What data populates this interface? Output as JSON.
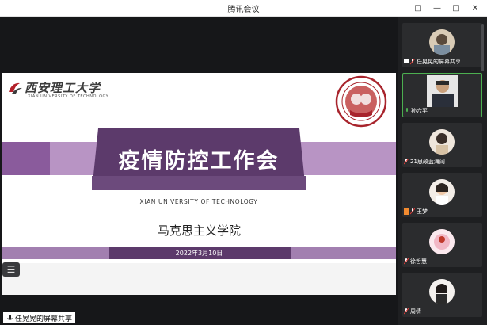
{
  "window": {
    "title": "腾讯会议",
    "controls": [
      "□",
      "—",
      "□",
      "✕"
    ]
  },
  "slide": {
    "logo_cn": "西安理工大学",
    "logo_en": "XIAN UNIVERSITY OF TECHNOLOGY",
    "title": "疫情防控工作会",
    "subtitle_en": "XIAN UNIVERSITY OF TECHNOLOGY",
    "school": "马克思主义学院",
    "date": "2022年3月10日"
  },
  "share_label": "任晃晃的屏幕共享",
  "participants": [
    {
      "name": "任晃晃的屏幕共享",
      "mic": "sharing"
    },
    {
      "name": "孙六平",
      "mic": "active"
    },
    {
      "name": "21思政蓝海阔",
      "mic": "muted"
    },
    {
      "name": "王梦",
      "mic": "muted"
    },
    {
      "name": "徐哲慧",
      "mic": "muted"
    },
    {
      "name": "周倩",
      "mic": "muted"
    }
  ],
  "colors": {
    "purple_dark": "#5c3a6b",
    "purple_light": "#b894c4",
    "active_border": "#4caf50"
  }
}
